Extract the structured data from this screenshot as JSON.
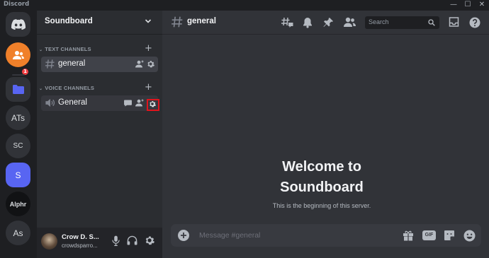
{
  "window": {
    "title": "Discord"
  },
  "servers": {
    "items": [
      {
        "label": "ATs"
      },
      {
        "label": "SC"
      },
      {
        "label": "S"
      },
      {
        "label": "Alphr"
      },
      {
        "label": "As"
      }
    ],
    "dm_badge": "1"
  },
  "guild": {
    "name": "Soundboard"
  },
  "categories": {
    "text": {
      "label": "TEXT CHANNELS"
    },
    "voice": {
      "label": "VOICE CHANNELS"
    }
  },
  "channels": {
    "text": [
      {
        "label": "general"
      }
    ],
    "voice": [
      {
        "label": "General"
      }
    ]
  },
  "user": {
    "name": "Crow D. S...",
    "tag": "crowdsparro..."
  },
  "header": {
    "channel": "general"
  },
  "search": {
    "placeholder": "Search"
  },
  "welcome": {
    "title_line1": "Welcome to",
    "title_line2": "Soundboard",
    "subtitle": "This is the beginning of this server."
  },
  "composer": {
    "placeholder": "Message #general",
    "gif_label": "GIF"
  },
  "colors": {
    "accent": "#5865f2",
    "highlight": "#e0141d",
    "dm_badge": "#f23f43",
    "friends_avatar": "#f0802a"
  }
}
